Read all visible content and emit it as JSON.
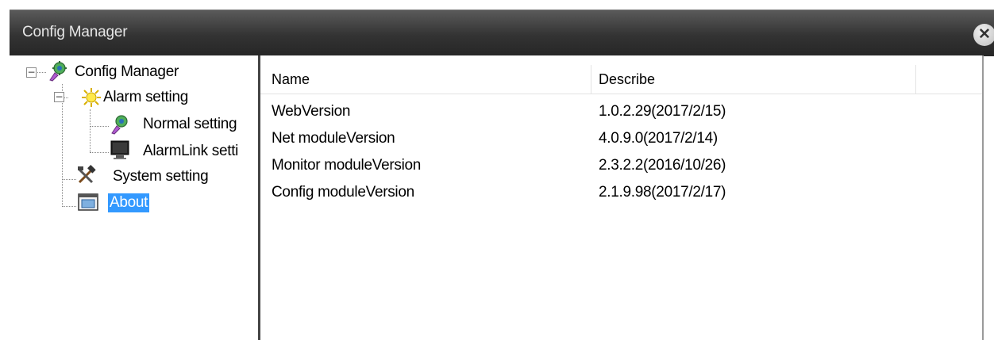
{
  "window": {
    "title": "Config Manager"
  },
  "tree": {
    "root": {
      "label": "Config Manager",
      "icon": "gear-lock-icon",
      "expander": "−"
    },
    "alarm": {
      "label": "Alarm setting",
      "icon": "alarm-sun-icon",
      "expander": "−"
    },
    "normal": {
      "label": "Normal setting",
      "icon": "gear-lock-icon"
    },
    "alarmlink": {
      "label": "AlarmLink setti",
      "icon": "monitor-icon"
    },
    "system": {
      "label": "System setting",
      "icon": "tools-icon"
    },
    "about": {
      "label": "About",
      "icon": "about-window-icon",
      "selected": true
    }
  },
  "list": {
    "columns": [
      "Name",
      "Describe"
    ],
    "rows": [
      {
        "name": "WebVersion",
        "describe": "1.0.2.29(2017/2/15)"
      },
      {
        "name": "Net moduleVersion",
        "describe": "4.0.9.0(2017/2/14)"
      },
      {
        "name": "Monitor moduleVersion",
        "describe": "2.3.2.2(2016/10/26)"
      },
      {
        "name": "Config moduleVersion",
        "describe": "2.1.9.98(2017/2/17)"
      }
    ]
  }
}
